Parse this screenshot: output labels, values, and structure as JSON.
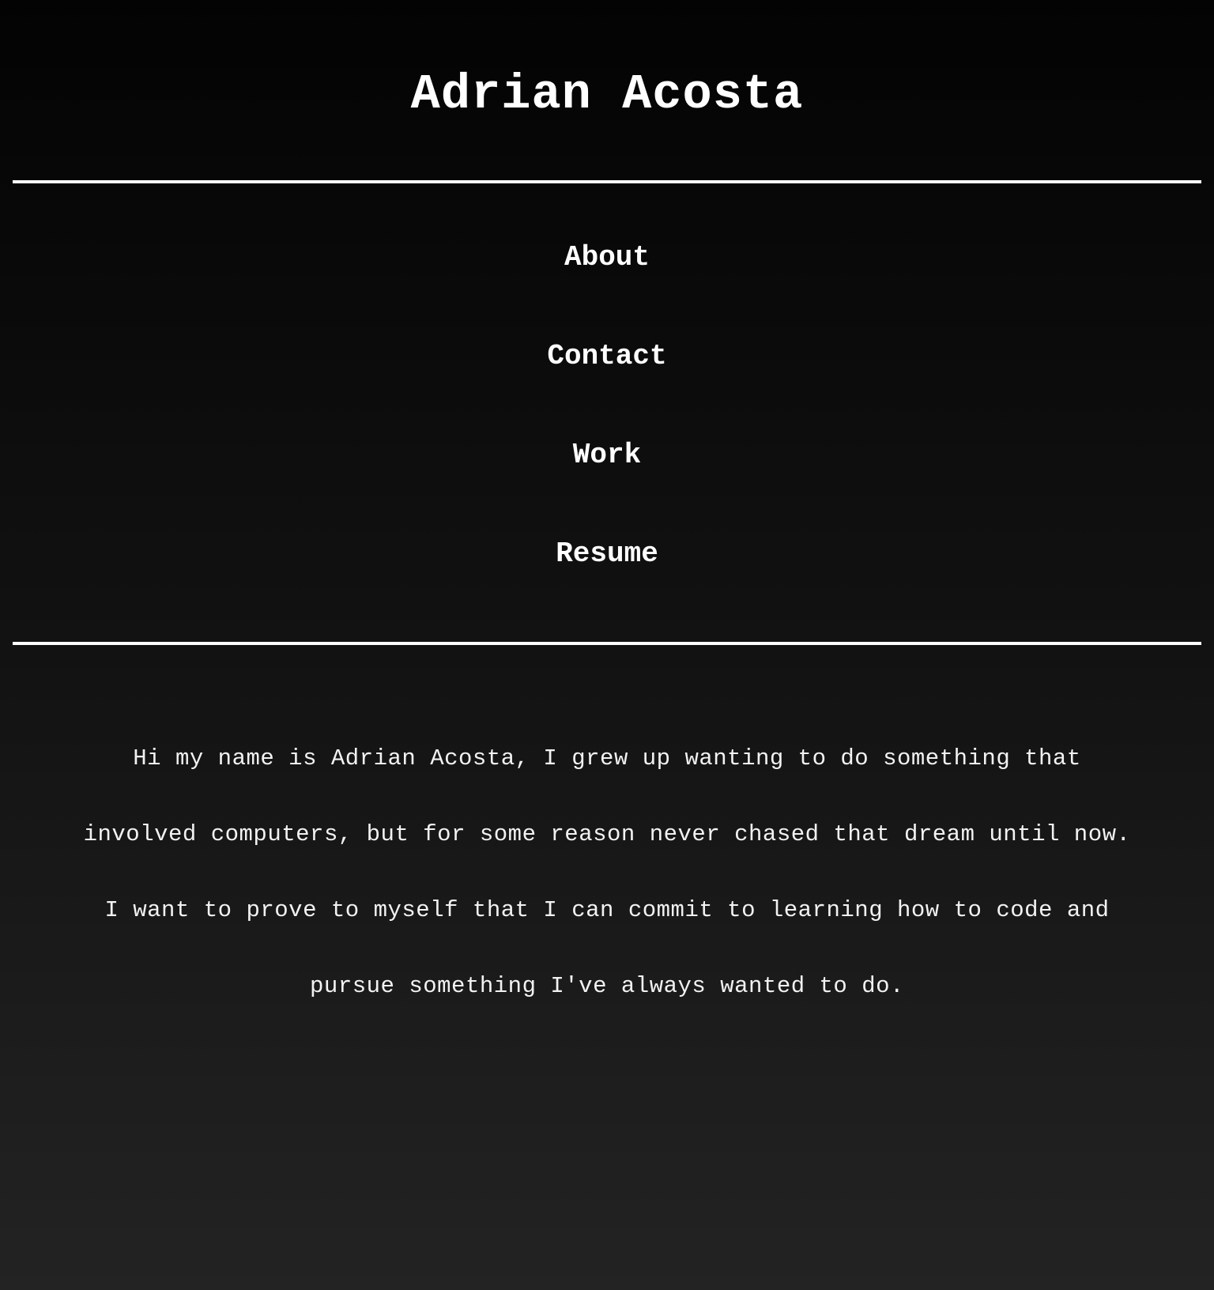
{
  "header": {
    "title": "Adrian Acosta"
  },
  "nav": {
    "items": [
      {
        "label": "About"
      },
      {
        "label": "Contact"
      },
      {
        "label": "Work"
      },
      {
        "label": "Resume"
      }
    ]
  },
  "about": {
    "text": "Hi my name is Adrian Acosta, I grew up wanting to do something that involved computers, but for some reason never chased that dream until now. I want to prove to myself that I can commit to learning how to code and pursue something I've always wanted to do."
  },
  "colors": {
    "text": "#ffffff",
    "background_top": "#030303",
    "background_bottom": "#232323",
    "divider": "#ffffff"
  }
}
